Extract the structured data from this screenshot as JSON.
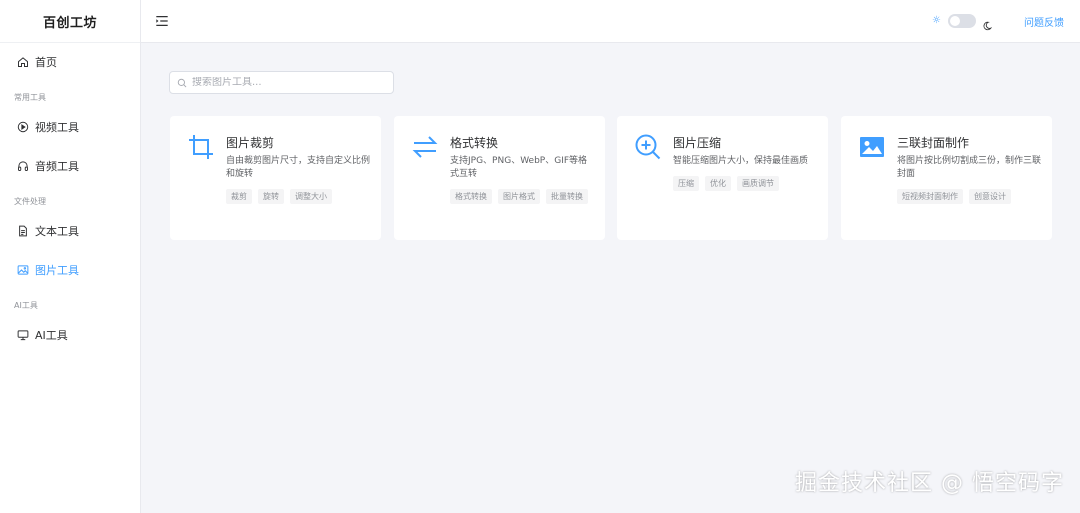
{
  "app": {
    "title": "百创工坊"
  },
  "sidebar": {
    "home": "首页",
    "groups": [
      {
        "label": "常用工具",
        "items": [
          {
            "label": "视频工具"
          },
          {
            "label": "音频工具"
          }
        ]
      },
      {
        "label": "文件处理",
        "items": [
          {
            "label": "文本工具"
          },
          {
            "label": "图片工具",
            "active": true
          }
        ]
      },
      {
        "label": "AI工具",
        "items": [
          {
            "label": "AI工具"
          }
        ]
      }
    ]
  },
  "header": {
    "feedback": "问题反馈",
    "theme_toggle": "off"
  },
  "search": {
    "placeholder": "搜索图片工具..."
  },
  "cards": [
    {
      "title": "图片裁剪",
      "desc": "自由裁剪图片尺寸，支持自定义比例和旋转",
      "tags": [
        "裁剪",
        "旋转",
        "调整大小"
      ],
      "icon": "crop-icon"
    },
    {
      "title": "格式转换",
      "desc": "支持JPG、PNG、WebP、GIF等格式互转",
      "tags": [
        "格式转换",
        "图片格式",
        "批量转换"
      ],
      "icon": "swap-icon"
    },
    {
      "title": "图片压缩",
      "desc": "智能压缩图片大小，保持最佳画质",
      "tags": [
        "压缩",
        "优化",
        "画质调节"
      ],
      "icon": "zoom-in-icon"
    },
    {
      "title": "三联封面制作",
      "desc": "将图片按比例切割成三份，制作三联封面",
      "tags": [
        "短视频封面制作",
        "创意设计"
      ],
      "icon": "image-icon"
    }
  ],
  "colors": {
    "accent": "#409eff",
    "background": "#f4f5f9"
  },
  "watermark": "掘金技术社区 @ 悟空码字"
}
